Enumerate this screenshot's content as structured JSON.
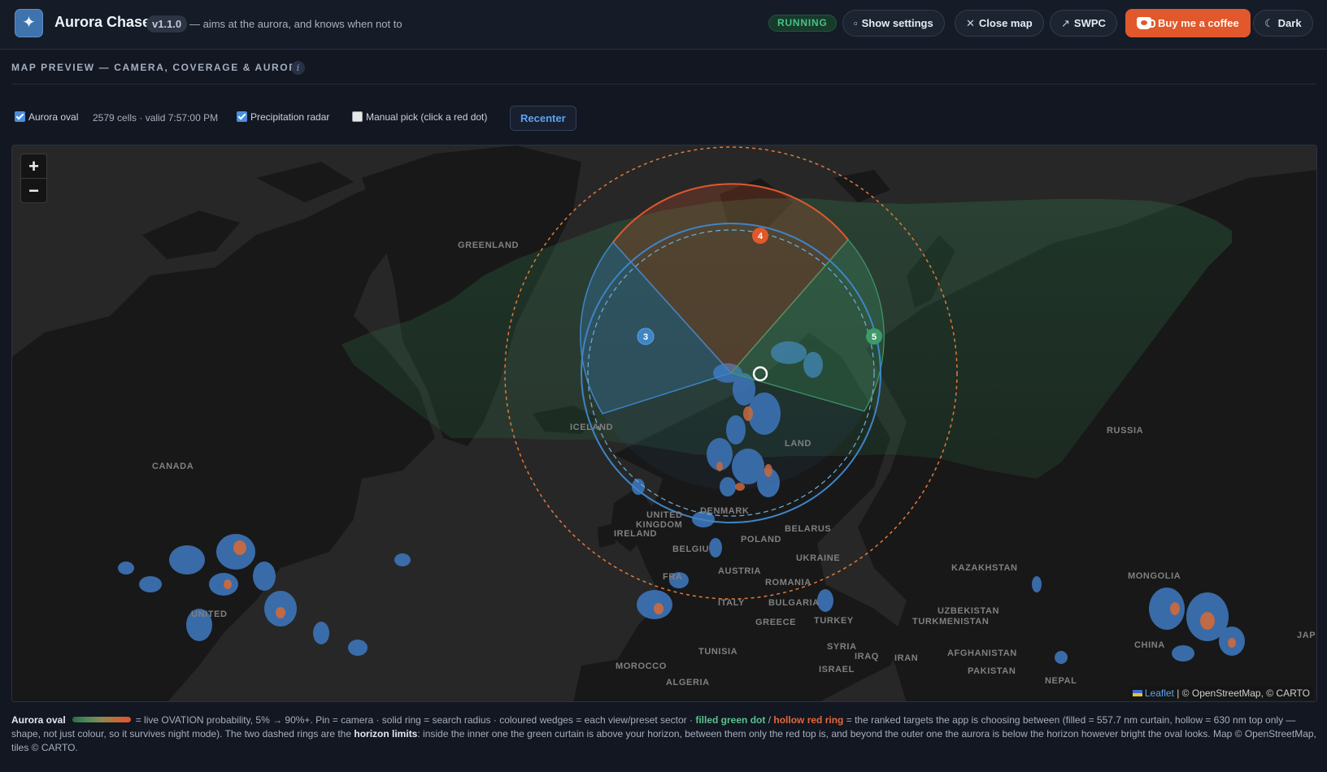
{
  "header": {
    "logo_icon": "sparkle-icon",
    "title": "Aurora Chaser",
    "version": "v1.1.0",
    "tagline": "— aims at the aurora, and knows when not to",
    "status": "RUNNING",
    "buttons": {
      "settings": "Show settings",
      "close_map": "Close map",
      "swpc": "SWPC",
      "coffee": "Buy me a coffee",
      "theme": "Dark"
    }
  },
  "section": {
    "title": "MAP PREVIEW — CAMERA, COVERAGE & AURORA",
    "info": "i"
  },
  "controls": {
    "aurora_oval": {
      "label": "Aurora oval",
      "checked": true
    },
    "cells_info": "2579 cells · valid 7:57:00 PM",
    "precip_radar": {
      "label": "Precipitation radar",
      "checked": true
    },
    "manual_pick": {
      "label": "Manual pick (click a red dot)",
      "checked": false
    },
    "recenter": "Recenter"
  },
  "map": {
    "zoom_in": "+",
    "zoom_out": "−",
    "attribution_leaflet": "Leaflet",
    "attribution_rest": "| © OpenStreetMap, © CARTO",
    "labels": {
      "greenland": "GREENLAND",
      "canada": "CANADA",
      "iceland": "ICELAND",
      "russia": "RUSSIA",
      "united_kingdom_1": "UNITED",
      "united_kingdom_2": "KINGDOM",
      "ireland": "IRELAND",
      "denmark": "DENMARK",
      "belarus": "BELARUS",
      "poland": "POLAND",
      "ukraine": "UKRAINE",
      "kazakhstan": "KAZAKHSTAN",
      "mongolia": "MONGOLIA",
      "austria": "AUSTRIA",
      "romania": "ROMANIA",
      "bulgaria": "BULGARIA",
      "italy": "ITALY",
      "greece": "GREECE",
      "turkey": "TURKEY",
      "uzbekistan": "UZBEKISTAN",
      "turkmenistan": "TURKMENISTAN",
      "afghanistan": "AFGHANISTAN",
      "iran": "IRAN",
      "iraq": "IRAQ",
      "syria": "SYRIA",
      "israel": "ISRAEL",
      "pakistan": "PAKISTAN",
      "nepal": "NEPAL",
      "china": "CHINA",
      "tunisia": "TUNISIA",
      "morocco": "MOROCCO",
      "algeria": "ALGERIA",
      "united_states": "UNITED",
      "belgium": "BELGIU",
      "france": "FRA",
      "finland": "LAND",
      "japan": "JAP"
    },
    "sectors": [
      {
        "id": "3",
        "color": "#3d85c6"
      },
      {
        "id": "4",
        "color": "#e0582c"
      },
      {
        "id": "5",
        "color": "#3f9a6a"
      }
    ]
  },
  "legend": {
    "lead": "Aurora oval",
    "p1": "= live OVATION probability, 5% → 90%+. Pin = camera · solid ring = search radius · coloured wedges = each view/preset sector ·",
    "green": "filled green dot",
    "slash": "/",
    "red": "hollow red ring",
    "p2": "= the ranked targets the app is choosing between (filled = 557.7 nm curtain, hollow = 630 nm top only — shape, not just colour, so it survives night mode). The two dashed rings are the",
    "horizon": "horizon limits",
    "p3": ": inside the inner one the green curtain is above your horizon, between them only the red top is, and beyond the outer one the aurora is below the horizon however bright the oval looks. Map © OpenStreetMap, tiles © CARTO."
  }
}
